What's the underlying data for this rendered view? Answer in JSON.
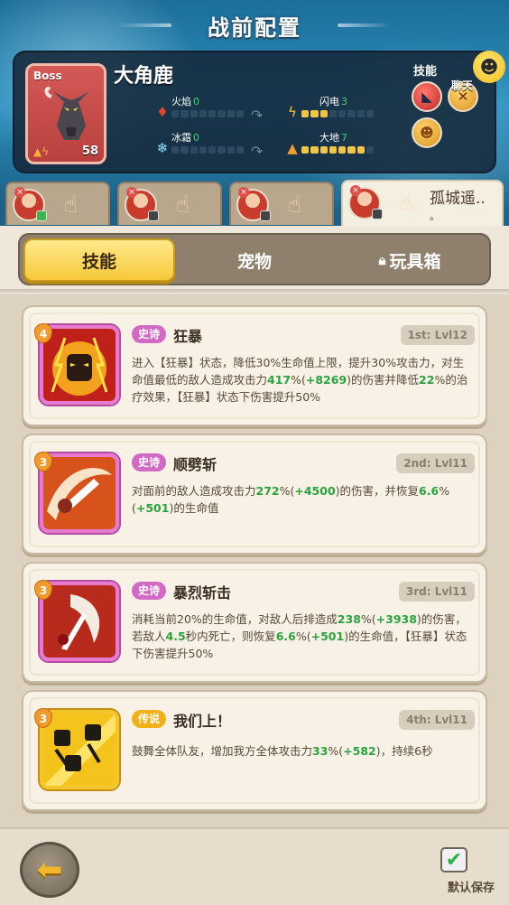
{
  "header": {
    "title": "战前配置"
  },
  "boss": {
    "tag": "Boss",
    "name": "大角鹿",
    "level": "58",
    "stats": [
      {
        "key": "fire",
        "label": "火焰",
        "value": "0",
        "icon": "fire-icon",
        "level": 0
      },
      {
        "key": "lightning",
        "label": "闪电",
        "value": "3",
        "icon": "lightning-icon",
        "level": 3
      },
      {
        "key": "ice",
        "label": "冰霜",
        "value": "0",
        "icon": "snowflake-icon",
        "level": 0
      },
      {
        "key": "earth",
        "label": "大地",
        "value": "7",
        "icon": "mountain-icon",
        "level": 7
      }
    ],
    "skills_label": "技能"
  },
  "chat": {
    "label": "聊天"
  },
  "heroes": [
    {
      "name": ""
    },
    {
      "name": ""
    },
    {
      "name": ""
    },
    {
      "name": "孤城遥..",
      "dot": "。"
    }
  ],
  "tabs": [
    {
      "label": "技能",
      "active": true
    },
    {
      "label": "宠物",
      "active": false
    },
    {
      "label": "玩具箱",
      "active": false,
      "locked": true
    }
  ],
  "skills": [
    {
      "number": "4",
      "rarity": "史诗",
      "name": "狂暴",
      "slot": "1st: Lvl12",
      "desc_parts": [
        {
          "t": "进入【狂暴】状态，降低30%生命值上限，提升30%攻击力，对生命值最低的敌人造成攻击力"
        },
        {
          "t": "417",
          "g": true
        },
        {
          "t": "%("
        },
        {
          "t": "+8269",
          "g": true
        },
        {
          "t": ")的伤害并降低"
        },
        {
          "t": "22",
          "g": true
        },
        {
          "t": "%的治疗效果，【狂暴】状态下伤害提升50%"
        }
      ]
    },
    {
      "number": "3",
      "rarity": "史诗",
      "name": "顺劈斩",
      "slot": "2nd: Lvl11",
      "desc_parts": [
        {
          "t": "对面前的敌人造成攻击力"
        },
        {
          "t": "272",
          "g": true
        },
        {
          "t": "%("
        },
        {
          "t": "+4500",
          "g": true
        },
        {
          "t": ")的伤害，并恢复"
        },
        {
          "t": "6.6",
          "g": true
        },
        {
          "t": "%("
        },
        {
          "t": "+501",
          "g": true
        },
        {
          "t": ")的生命值"
        }
      ]
    },
    {
      "number": "3",
      "rarity": "史诗",
      "name": "暴烈斩击",
      "slot": "3rd: Lvl11",
      "desc_parts": [
        {
          "t": "消耗当前20%的生命值，对敌人后排造成"
        },
        {
          "t": "238",
          "g": true
        },
        {
          "t": "%("
        },
        {
          "t": "+3938",
          "g": true
        },
        {
          "t": ")的伤害，若敌人"
        },
        {
          "t": "4.5",
          "g": true
        },
        {
          "t": "秒内死亡，则恢复"
        },
        {
          "t": "6.6",
          "g": true
        },
        {
          "t": "%("
        },
        {
          "t": "+501",
          "g": true
        },
        {
          "t": ")的生命值，【狂暴】状态下伤害提升50%"
        }
      ]
    },
    {
      "number": "3",
      "rarity": "传说",
      "name": "我们上！",
      "slot": "4th: Lvl11",
      "desc_parts": [
        {
          "t": "鼓舞全体队友，增加我方全体攻击力"
        },
        {
          "t": "33",
          "g": true
        },
        {
          "t": "%("
        },
        {
          "t": "+582",
          "g": true
        },
        {
          "t": ")，持续6秒"
        }
      ]
    }
  ],
  "footer": {
    "save_label": "默认保存"
  },
  "colors": {
    "accent_gold": "#f6c93b",
    "epic": "#d26ac5",
    "legend": "#f2b019",
    "bonus_green": "#2aa33e"
  }
}
